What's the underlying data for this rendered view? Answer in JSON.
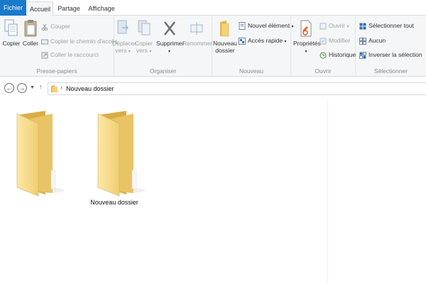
{
  "tabs": {
    "file": "Fichier",
    "home": "Accueil",
    "share": "Partage",
    "view": "Affichage"
  },
  "ribbon": {
    "clipboard": {
      "title": "Presse-papiers",
      "copy": "Copier",
      "paste": "Coller",
      "cut": "Couper",
      "copy_path": "Copier le chemin d'accès",
      "paste_shortcut": "Coller le raccourci"
    },
    "organize": {
      "title": "Organiser",
      "move_to_1": "Déplacer",
      "move_to_2": "vers",
      "copy_to_1": "Copier",
      "copy_to_2": "vers",
      "delete": "Supprimer",
      "rename": "Renommer"
    },
    "new": {
      "title": "Nouveau",
      "new_folder_1": "Nouveau",
      "new_folder_2": "dossier",
      "new_item": "Nouvel élément",
      "easy_access": "Accès rapide"
    },
    "open": {
      "title": "Ouvrir",
      "properties": "Propriétés",
      "open": "Ouvrir",
      "edit": "Modifier",
      "history": "Historique"
    },
    "select": {
      "title": "Sélectionner",
      "select_all": "Sélectionner tout",
      "select_none": "Aucun",
      "invert": "Inverser la sélection"
    }
  },
  "navigation": {
    "back_icon": "arrow-left-icon",
    "forward_icon": "arrow-right-icon",
    "recent_icon": "chevron-down-icon",
    "up_icon": "arrow-up-icon",
    "breadcrumb": "Nouveau dossier"
  },
  "files": [
    {
      "name": "",
      "type": "folder"
    },
    {
      "name": "Nouveau dossier",
      "type": "folder"
    }
  ],
  "colors": {
    "file_tab": "#1979ca",
    "ribbon_bg": "#f5f6f7",
    "folder_front": "#f3d37b",
    "folder_back": "#e3b84f"
  }
}
